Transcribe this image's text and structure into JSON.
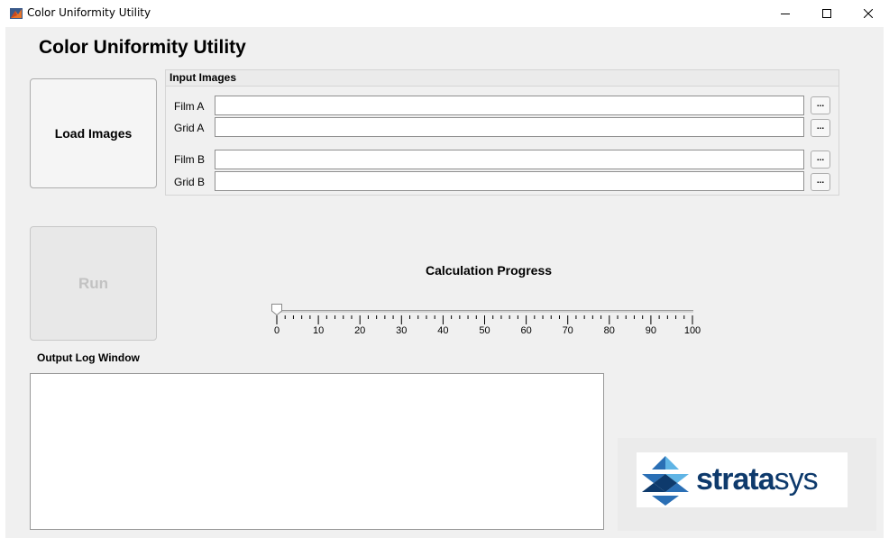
{
  "window": {
    "title": "Color Uniformity Utility",
    "controls": {
      "minimize": "–",
      "maximize": "☐",
      "close": "✕"
    }
  },
  "app": {
    "title": "Color Uniformity Utility",
    "load_button_label": "Load Images",
    "run_button_label": "Run",
    "run_button_enabled": false
  },
  "input_panel": {
    "title": "Input Images",
    "fields": [
      {
        "label": "Film A",
        "value": "",
        "browse_label": "..."
      },
      {
        "label": "Grid A",
        "value": "",
        "browse_label": "..."
      },
      {
        "label": "Film B",
        "value": "",
        "browse_label": "..."
      },
      {
        "label": "Grid B",
        "value": "",
        "browse_label": "..."
      }
    ]
  },
  "progress": {
    "title": "Calculation Progress",
    "value": 0,
    "min": 0,
    "max": 100,
    "tick_labels": [
      "0",
      "10",
      "20",
      "30",
      "40",
      "50",
      "60",
      "70",
      "80",
      "90",
      "100"
    ]
  },
  "log": {
    "label": "Output Log Window",
    "content": ""
  },
  "logo": {
    "text_bold": "strata",
    "text_light": "sys",
    "colors": {
      "navy": "#0e3a6c",
      "blue": "#2a6fb5",
      "light_blue": "#5fb4e5"
    }
  },
  "colors": {
    "background": "#f0f0f0",
    "disabled_text": "#c2c2c2",
    "border": "#adadad"
  }
}
